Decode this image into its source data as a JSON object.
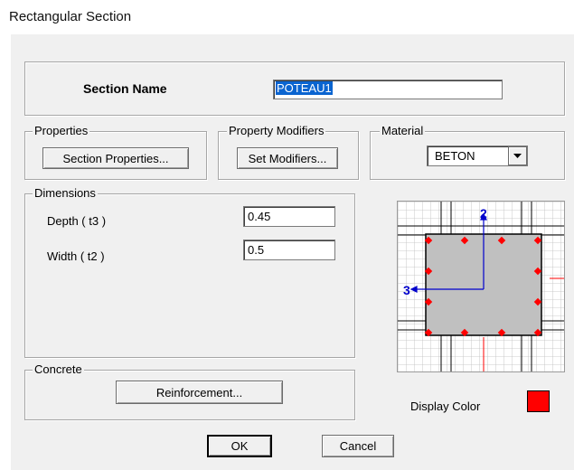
{
  "window": {
    "title": "Rectangular Section"
  },
  "section": {
    "label": "Section Name",
    "name_value": "POTEAU1"
  },
  "properties": {
    "group_label": "Properties",
    "button_label": "Section Properties..."
  },
  "modifiers": {
    "group_label": "Property Modifiers",
    "button_label": "Set Modifiers..."
  },
  "material": {
    "group_label": "Material",
    "selected": "BETON",
    "arrow_icon": "chevron-down-icon"
  },
  "dimensions": {
    "group_label": "Dimensions",
    "depth_label": "Depth  ( t3 )",
    "depth_value": "0.45",
    "width_label": "Width  ( t2 )",
    "width_value": "0.5"
  },
  "concrete": {
    "group_label": "Concrete",
    "button_label": "Reinforcement..."
  },
  "preview": {
    "axis2_label": "2",
    "axis3_label": "3",
    "section_fill": "#c0c0c0",
    "rebar_color": "#ff0000",
    "axis_color": "#0000cc"
  },
  "display_color": {
    "label": "Display Color",
    "swatch": "#ff0000"
  },
  "footer": {
    "ok_label": "OK",
    "cancel_label": "Cancel"
  }
}
